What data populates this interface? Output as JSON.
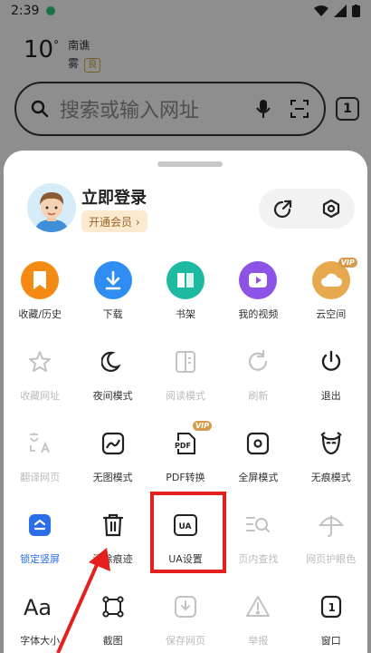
{
  "status_bar": {
    "time": "2:39"
  },
  "weather": {
    "temperature": "10",
    "unit": "°",
    "city": "南谯",
    "condition": "雾",
    "aqi": "良"
  },
  "search": {
    "placeholder": "搜索或输入网址"
  },
  "tab_count": "1",
  "sheet": {
    "login_label": "立即登录",
    "vip_button": "开通会员 ›"
  },
  "menu": [
    {
      "label": "收藏/历史",
      "icon": "bookmark-icon",
      "state": "normal"
    },
    {
      "label": "下载",
      "icon": "download-icon",
      "state": "normal"
    },
    {
      "label": "书架",
      "icon": "bookshelf-icon",
      "state": "normal"
    },
    {
      "label": "我的视频",
      "icon": "video-icon",
      "state": "normal"
    },
    {
      "label": "云空间",
      "icon": "cloud-icon",
      "state": "normal",
      "badge": "VIP"
    },
    {
      "label": "收藏网址",
      "icon": "star-icon",
      "state": "disabled"
    },
    {
      "label": "夜间模式",
      "icon": "moon-icon",
      "state": "normal"
    },
    {
      "label": "阅读模式",
      "icon": "reader-icon",
      "state": "disabled"
    },
    {
      "label": "刷新",
      "icon": "refresh-icon",
      "state": "disabled"
    },
    {
      "label": "退出",
      "icon": "power-icon",
      "state": "normal"
    },
    {
      "label": "翻译网页",
      "icon": "translate-icon",
      "state": "disabled"
    },
    {
      "label": "无图模式",
      "icon": "no-image-icon",
      "state": "normal"
    },
    {
      "label": "PDF转换",
      "icon": "pdf-icon",
      "state": "normal",
      "badge": "VIP"
    },
    {
      "label": "全屏模式",
      "icon": "fullscreen-icon",
      "state": "normal"
    },
    {
      "label": "无痕模式",
      "icon": "incognito-icon",
      "state": "normal"
    },
    {
      "label": "锁定竖屏",
      "icon": "lock-portrait-icon",
      "state": "active"
    },
    {
      "label": "清除痕迹",
      "icon": "trash-icon",
      "state": "normal"
    },
    {
      "label": "UA设置",
      "icon": "ua-icon",
      "state": "normal"
    },
    {
      "label": "页内查找",
      "icon": "find-in-page-icon",
      "state": "disabled"
    },
    {
      "label": "网页护眼色",
      "icon": "umbrella-icon",
      "state": "disabled"
    },
    {
      "label": "字体大小",
      "icon": "font-size-icon",
      "state": "normal"
    },
    {
      "label": "截图",
      "icon": "screenshot-icon",
      "state": "normal"
    },
    {
      "label": "保存网页",
      "icon": "save-page-icon",
      "state": "disabled"
    },
    {
      "label": "举报",
      "icon": "report-icon",
      "state": "disabled"
    },
    {
      "label": "窗口",
      "icon": "window-icon",
      "state": "normal",
      "text": "1"
    }
  ]
}
